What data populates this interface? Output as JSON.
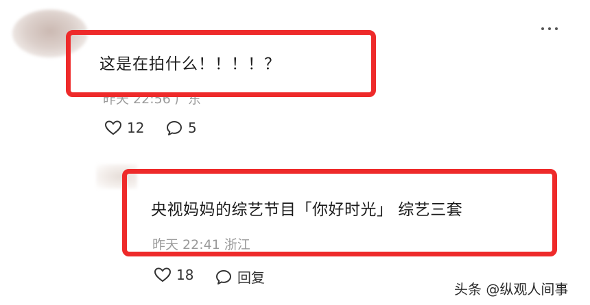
{
  "comment1": {
    "text": "这是在拍什么！！！！？",
    "meta": "昨天 22:56 广东",
    "likes": "12",
    "replies": "5"
  },
  "comment2": {
    "text": "央视妈妈的综艺节目「你好时光」 综艺三套",
    "meta": "昨天 22:41 浙江",
    "likes": "18",
    "reply_label": "回复"
  },
  "watermark": "头条 @纵观人间事",
  "colors": {
    "highlight": "#ee2a2a",
    "meta": "#9a9a9a"
  },
  "icons": [
    "more-icon",
    "heart-icon",
    "comment-icon"
  ]
}
